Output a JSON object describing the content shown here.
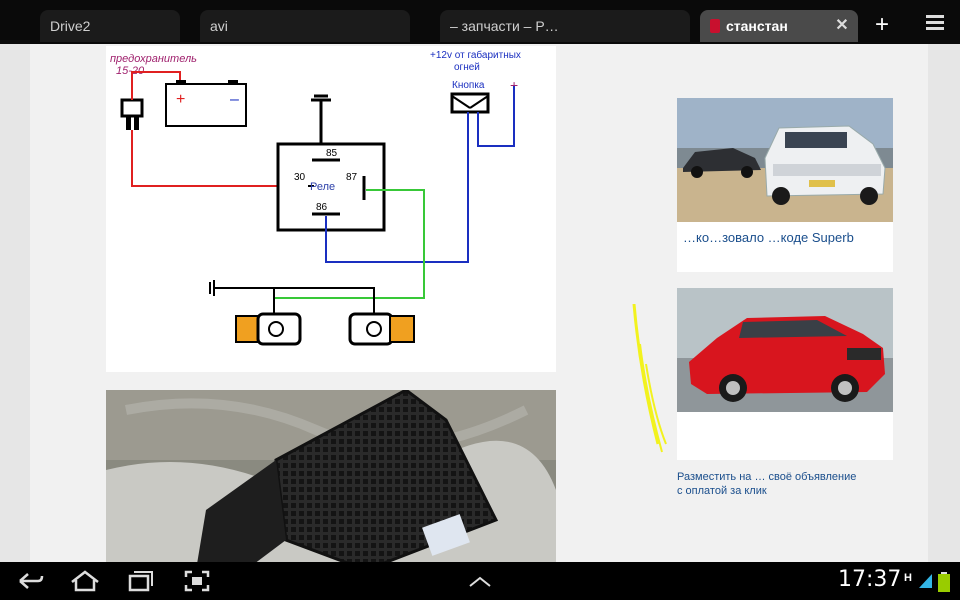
{
  "tabs": [
    {
      "label": "Drive2"
    },
    {
      "label": "avi"
    },
    {
      "label": "– запчасти – Р…"
    },
    {
      "label": "станстан"
    }
  ],
  "diagram": {
    "fuse_label": "предохранитель",
    "fuse_rating": "15-20",
    "battery_plus": "+",
    "battery_minus": "–",
    "source_label_line1": "+12v от габаритных",
    "source_label_line2": "огней",
    "button_label": "Кнопка",
    "button_plus": "+",
    "relay_label": "Реле",
    "pin_85": "85",
    "pin_30": "30",
    "pin_87": "87",
    "pin_86": "86"
  },
  "ads": [
    {
      "title": "…ко…зовало …коде Superb"
    },
    {
      "title": ""
    }
  ],
  "ad_note": {
    "line1": "Разместить на … своё объявление",
    "line2": "с оплатой за клик"
  },
  "status": {
    "time": "17:37",
    "network": "H"
  },
  "colors": {
    "red_wire": "#e02020",
    "blue_wire": "#1a2fc0",
    "green_wire": "#38c838",
    "relay_blue": "#2b3fa8",
    "link_blue": "#1a4e8c",
    "fuse_magenta": "#a0226e"
  },
  "icons": {
    "back": "back-icon",
    "home": "home-icon",
    "recents": "recent-apps-icon",
    "screenshot": "screenshot-icon",
    "up": "chevron-up-icon",
    "menu": "overflow-menu-icon"
  }
}
